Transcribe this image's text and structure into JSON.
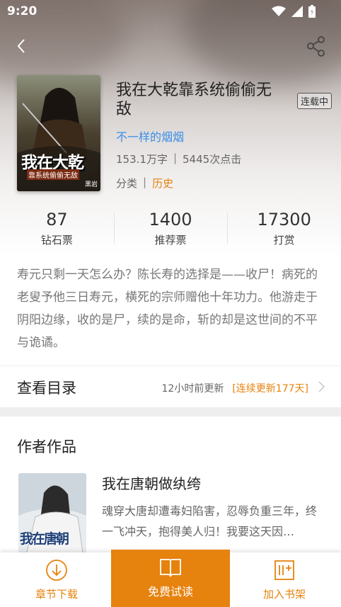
{
  "status_bar": {
    "time": "9:20"
  },
  "book": {
    "title": "我在大乾靠系统偷偷无敌",
    "status_badge": "连载中",
    "author": "不一样的烟烟",
    "word_count": "153.1万字",
    "clicks": "5445次点击",
    "category_label": "分类",
    "category_value": "历史",
    "cover_text": "我在大乾",
    "cover_subtitle": "靠系统偷偷无敌",
    "cover_brand": "黑岩"
  },
  "stats": [
    {
      "value": "87",
      "label": "钻石票"
    },
    {
      "value": "1400",
      "label": "推荐票"
    },
    {
      "value": "17300",
      "label": "打赏"
    }
  ],
  "intro": "寿元只剩一天怎么办？陈长寿的选择是——收尸！病死的老叟予他三日寿元，横死的宗师赠他十年功力。他游走于阴阳边缘，收的是尸，续的是命，斩的却是这世间的不平与诡谲。",
  "toc": {
    "label": "查看目录",
    "updated": "12小时前更新",
    "update_count": "[连续更新177天]"
  },
  "author_works": {
    "section_title": "作者作品",
    "items": [
      {
        "title": "我在唐朝做纨绔",
        "description": "魂穿大唐却遭毒妇陷害，忍辱负重三年，终一飞冲天，抱得美人归！我要这天因…",
        "cover_text": "我在唐朝"
      }
    ]
  },
  "bottom_bar": {
    "download_label": "章节下载",
    "read_label": "免费试读",
    "shelf_label": "加入书架"
  },
  "colors": {
    "accent": "#e6820e",
    "link": "#3a8ee6"
  },
  "icons": [
    "back-icon",
    "share-icon",
    "wifi-icon",
    "signal-icon",
    "battery-icon",
    "chevron-right-icon",
    "download-icon",
    "book-open-icon",
    "add-to-shelf-icon"
  ]
}
